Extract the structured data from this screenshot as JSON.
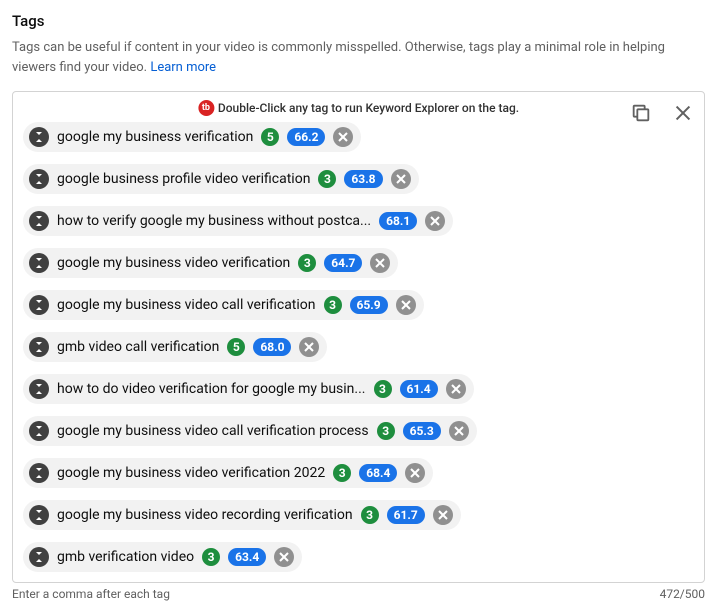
{
  "section": {
    "title": "Tags",
    "description_prefix": "Tags can be useful if content in your video is commonly misspelled. Otherwise, tags play a minimal role in helping viewers find your video. ",
    "learn_more": "Learn more"
  },
  "hint": {
    "icon_text": "tb",
    "text": "Double-Click any tag to run Keyword Explorer on the tag."
  },
  "tags": [
    {
      "text": "google my business verification",
      "count": "5",
      "score": "66.2"
    },
    {
      "text": "google business profile video verification",
      "count": "3",
      "score": "63.8"
    },
    {
      "text": "how to verify google my business without postca...",
      "count": null,
      "score": "68.1"
    },
    {
      "text": "google my business video verification",
      "count": "3",
      "score": "64.7"
    },
    {
      "text": "google my business video call verification",
      "count": "3",
      "score": "65.9"
    },
    {
      "text": "gmb video call verification",
      "count": "5",
      "score": "68.0"
    },
    {
      "text": "how to do video verification for google my busin...",
      "count": "3",
      "score": "61.4"
    },
    {
      "text": "google my business video call verification process",
      "count": "3",
      "score": "65.3"
    },
    {
      "text": "google my business video verification 2022",
      "count": "3",
      "score": "68.4"
    },
    {
      "text": "google my business video recording verification",
      "count": "3",
      "score": "61.7"
    },
    {
      "text": "gmb verification video",
      "count": "3",
      "score": "63.4"
    }
  ],
  "footer": {
    "hint": "Enter a comma after each tag",
    "counter": "472/500"
  }
}
